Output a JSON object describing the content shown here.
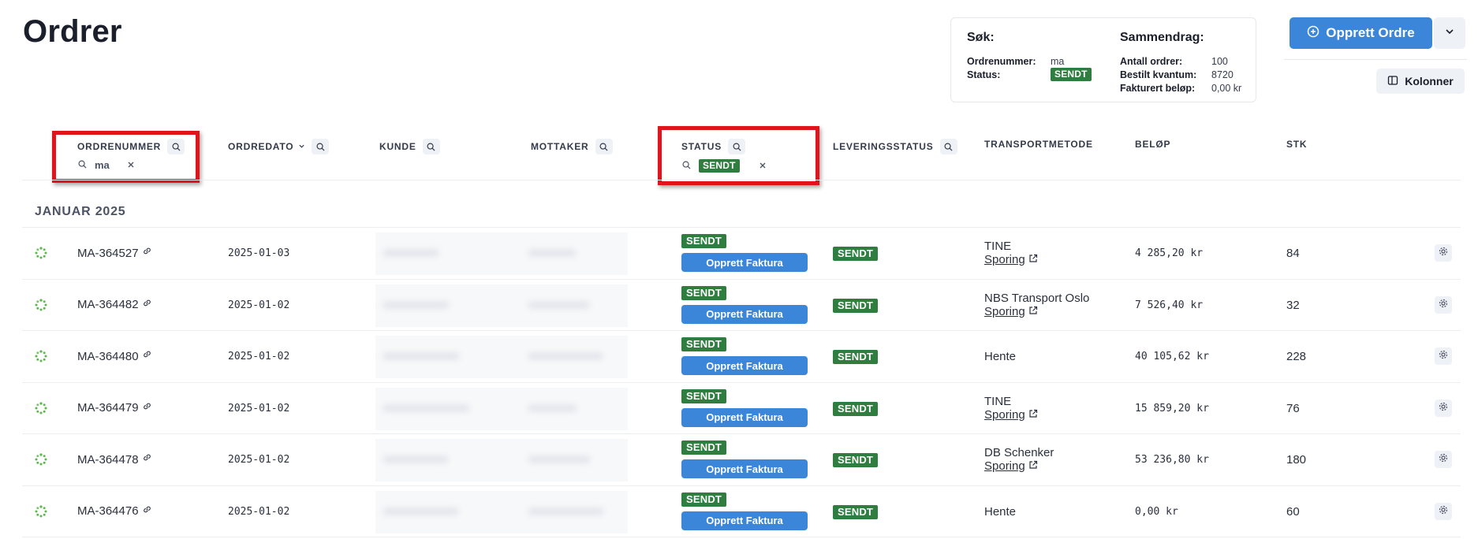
{
  "page_title": "Ordrer",
  "summary": {
    "search_header": "Søk:",
    "search_fields": [
      {
        "label": "Ordrenummer:",
        "value": "ma"
      },
      {
        "label": "Status:",
        "value": "SENDT"
      }
    ],
    "summary_header": "Sammendrag:",
    "summary_fields": [
      {
        "label": "Antall ordrer:",
        "value": "100"
      },
      {
        "label": "Bestilt kvantum:",
        "value": "8720"
      },
      {
        "label": "Fakturert beløp:",
        "value": "0,00 kr"
      }
    ]
  },
  "actions": {
    "create_order": "Opprett Ordre",
    "columns": "Kolonner"
  },
  "columns": {
    "order_number": "ORDRENUMMER",
    "order_date": "ORDREDATO",
    "customer": "KUNDE",
    "recipient": "MOTTAKER",
    "status": "STATUS",
    "delivery_status": "LEVERINGSSTATUS",
    "transport_method": "TRANSPORTMETODE",
    "amount": "BELØP",
    "qty": "STK"
  },
  "filters": {
    "order_number": "ma",
    "status": "SENDT"
  },
  "group_label": "JANUAR 2025",
  "invoice_label": "Opprett Faktura",
  "tracking_label": "Sporing",
  "colors": {
    "accent": "#3b86d8",
    "status_green": "#2f7d3f",
    "highlight_red": "#e1141b"
  },
  "rows": [
    {
      "order": "MA-364527",
      "date": "2025-01-03",
      "status": "SENDT",
      "delivery": "SENDT",
      "transport": "TINE",
      "tracking": true,
      "amount": "4 285,20 kr",
      "qty": "84"
    },
    {
      "order": "MA-364482",
      "date": "2025-01-02",
      "status": "SENDT",
      "delivery": "SENDT",
      "transport": "NBS Transport Oslo",
      "tracking": true,
      "amount": "7 526,40 kr",
      "qty": "32"
    },
    {
      "order": "MA-364480",
      "date": "2025-01-02",
      "status": "SENDT",
      "delivery": "SENDT",
      "transport": "Hente",
      "tracking": false,
      "amount": "40 105,62 kr",
      "qty": "228"
    },
    {
      "order": "MA-364479",
      "date": "2025-01-02",
      "status": "SENDT",
      "delivery": "SENDT",
      "transport": "TINE",
      "tracking": true,
      "amount": "15 859,20 kr",
      "qty": "76"
    },
    {
      "order": "MA-364478",
      "date": "2025-01-02",
      "status": "SENDT",
      "delivery": "SENDT",
      "transport": "DB Schenker",
      "tracking": true,
      "amount": "53 236,80 kr",
      "qty": "180"
    },
    {
      "order": "MA-364476",
      "date": "2025-01-02",
      "status": "SENDT",
      "delivery": "SENDT",
      "transport": "Hente",
      "tracking": false,
      "amount": "0,00 kr",
      "qty": "60"
    }
  ]
}
